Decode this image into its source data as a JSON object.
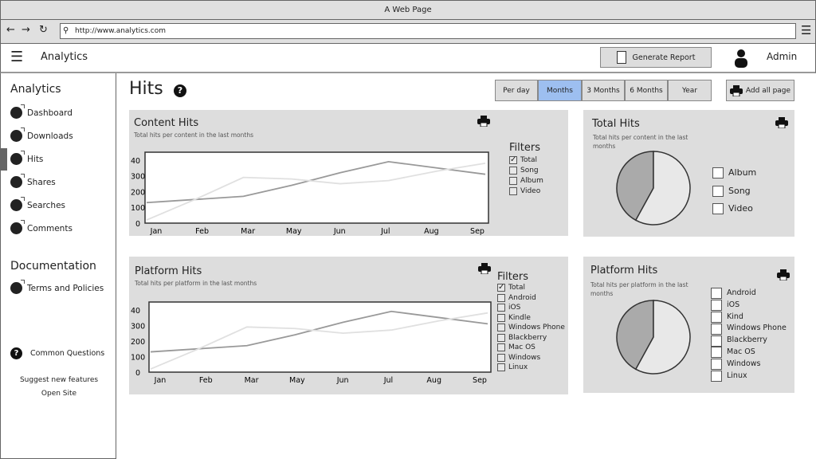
{
  "browser": {
    "title": "A Web Page",
    "url": "http://www.analytics.com"
  },
  "header": {
    "app_name": "Analytics",
    "generate_report": "Generate Report",
    "user": "Admin"
  },
  "sidebar": {
    "section1": "Analytics",
    "items": [
      {
        "label": "Dashboard"
      },
      {
        "label": "Downloads"
      },
      {
        "label": "Hits",
        "active": true
      },
      {
        "label": "Shares"
      },
      {
        "label": "Searches"
      },
      {
        "label": "Comments"
      }
    ],
    "section2": "Documentation",
    "doc_items": [
      {
        "label": "Terms and Policies"
      }
    ],
    "common_questions": "Common Questions",
    "suggest": "Suggest new features",
    "open_site": "Open Site"
  },
  "page": {
    "title": "Hits",
    "add_all_page": "Add all page",
    "periods": [
      {
        "label": "Per day"
      },
      {
        "label": "Months",
        "selected": true
      },
      {
        "label": "3 Months"
      },
      {
        "label": "6 Months"
      },
      {
        "label": "Year"
      }
    ],
    "accent": "#9dbff0"
  },
  "content_hits": {
    "title": "Content Hits",
    "subtitle": "Total hits per content in the last months",
    "filters_title": "Filters",
    "filters": [
      {
        "label": "Total",
        "checked": true
      },
      {
        "label": "Song",
        "checked": false
      },
      {
        "label": "Album",
        "checked": false
      },
      {
        "label": "Video",
        "checked": false
      }
    ]
  },
  "platform_hits": {
    "title": "Platform Hits",
    "subtitle": "Total hits per platform in the last months",
    "filters_title": "Filters",
    "filters": [
      {
        "label": "Total",
        "checked": true
      },
      {
        "label": "Android",
        "checked": false
      },
      {
        "label": "iOS",
        "checked": false
      },
      {
        "label": "Kindle",
        "checked": false
      },
      {
        "label": "Windows Phone",
        "checked": false
      },
      {
        "label": "Blackberry",
        "checked": false
      },
      {
        "label": "Mac OS",
        "checked": false
      },
      {
        "label": "Windows",
        "checked": false
      },
      {
        "label": "Linux",
        "checked": false
      }
    ]
  },
  "total_hits": {
    "title": "Total Hits",
    "subtitle": "Total hits per content in the last months",
    "legend": [
      "Album",
      "Song",
      "Video"
    ]
  },
  "platform_pie": {
    "title": "Platform Hits",
    "subtitle": "Total hits per platform in the last months",
    "legend": [
      "Android",
      "iOS",
      "Kind",
      "Windows Phone",
      "Blackberry",
      "Mac OS",
      "Windows",
      "Linux"
    ]
  },
  "chart_data": [
    {
      "type": "line",
      "categories": [
        "Jan",
        "Feb",
        "Mar",
        "May",
        "Jun",
        "Jul",
        "Aug",
        "Sep"
      ],
      "yticks": [
        "0",
        "100",
        "200",
        "300",
        "40"
      ],
      "ylim": [
        0,
        450
      ],
      "series": [
        {
          "values": [
            130,
            150,
            170,
            240,
            320,
            390,
            350,
            310
          ],
          "color": "#999999"
        },
        {
          "values": [
            20,
            150,
            290,
            280,
            250,
            270,
            330,
            380
          ],
          "color": "#e0e0e0"
        }
      ]
    },
    {
      "type": "line",
      "categories": [
        "Jan",
        "Feb",
        "Mar",
        "May",
        "Jun",
        "Jul",
        "Aug",
        "Sep"
      ],
      "yticks": [
        "0",
        "100",
        "200",
        "300",
        "40"
      ],
      "ylim": [
        0,
        450
      ],
      "series": [
        {
          "values": [
            130,
            150,
            170,
            240,
            320,
            390,
            350,
            310
          ],
          "color": "#999999"
        },
        {
          "values": [
            20,
            150,
            290,
            280,
            250,
            270,
            330,
            380
          ],
          "color": "#e0e0e0"
        }
      ]
    },
    {
      "type": "pie",
      "values": [
        42,
        58
      ],
      "colors": [
        "#aaaaaa",
        "#e8e8e8"
      ]
    },
    {
      "type": "pie",
      "values": [
        42,
        58
      ],
      "colors": [
        "#aaaaaa",
        "#e8e8e8"
      ]
    }
  ]
}
